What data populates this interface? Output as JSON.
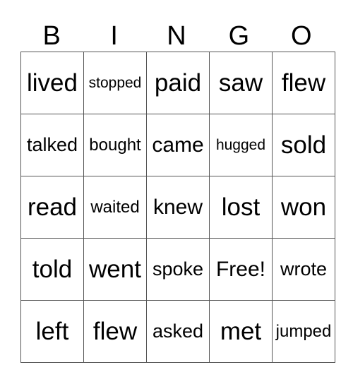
{
  "header": [
    "B",
    "I",
    "N",
    "G",
    "O"
  ],
  "rows": [
    [
      "lived",
      "stopped",
      "paid",
      "saw",
      "flew"
    ],
    [
      "talked",
      "bought",
      "came",
      "hugged",
      "sold"
    ],
    [
      "read",
      "waited",
      "knew",
      "lost",
      "won"
    ],
    [
      "told",
      "went",
      "spoke",
      "Free!",
      "wrote"
    ],
    [
      "left",
      "flew",
      "asked",
      "met",
      "jumped"
    ]
  ]
}
